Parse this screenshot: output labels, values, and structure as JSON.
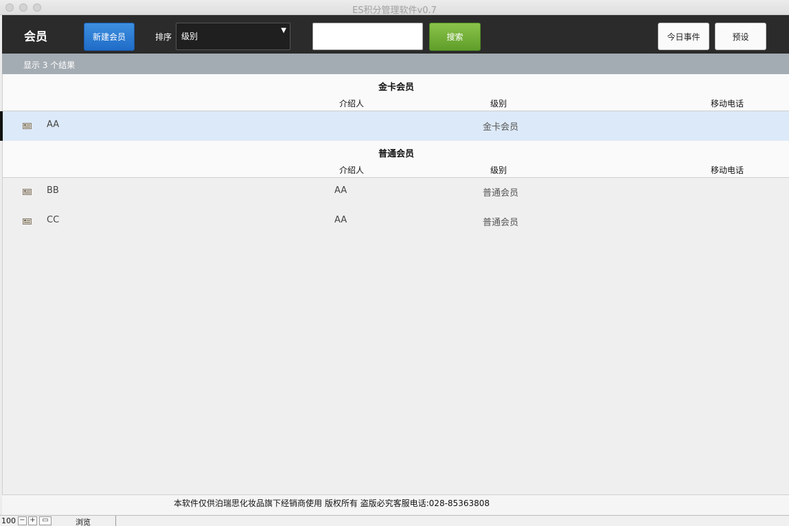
{
  "window": {
    "title": "ES积分管理软件v0.7"
  },
  "toolbar": {
    "title": "会员",
    "new_member_label": "新建会员",
    "sort_label": "排序",
    "sort_value": "级别",
    "search_value": "",
    "search_label": "搜索",
    "today_events_label": "今日事件",
    "presets_label": "预设"
  },
  "results": {
    "summary": "显示 3 个结果"
  },
  "groups": [
    {
      "title": "金卡会员",
      "columns": {
        "referrer": "介绍人",
        "level": "级别",
        "phone": "移动电话"
      },
      "rows": [
        {
          "name": "AA",
          "referrer": "",
          "level": "金卡会员",
          "phone": ""
        }
      ]
    },
    {
      "title": "普通会员",
      "columns": {
        "referrer": "介绍人",
        "level": "级别",
        "phone": "移动电话"
      },
      "rows": [
        {
          "name": "BB",
          "referrer": "AA",
          "level": "普通会员",
          "phone": ""
        },
        {
          "name": "CC",
          "referrer": "AA",
          "level": "普通会员",
          "phone": ""
        }
      ]
    }
  ],
  "footer": {
    "text": "本软件仅供泊瑞思化妆品旗下经销商使用 版权所有 盗版必究客服电话:028-85363808"
  },
  "statusbar": {
    "zoom": "100",
    "mode": "浏览"
  },
  "colors": {
    "toolbar_bg": "#2b2b2b",
    "new_button": "#1f6cc7",
    "search_button": "#5f9e2a",
    "selected_row": "#dce9f8"
  }
}
